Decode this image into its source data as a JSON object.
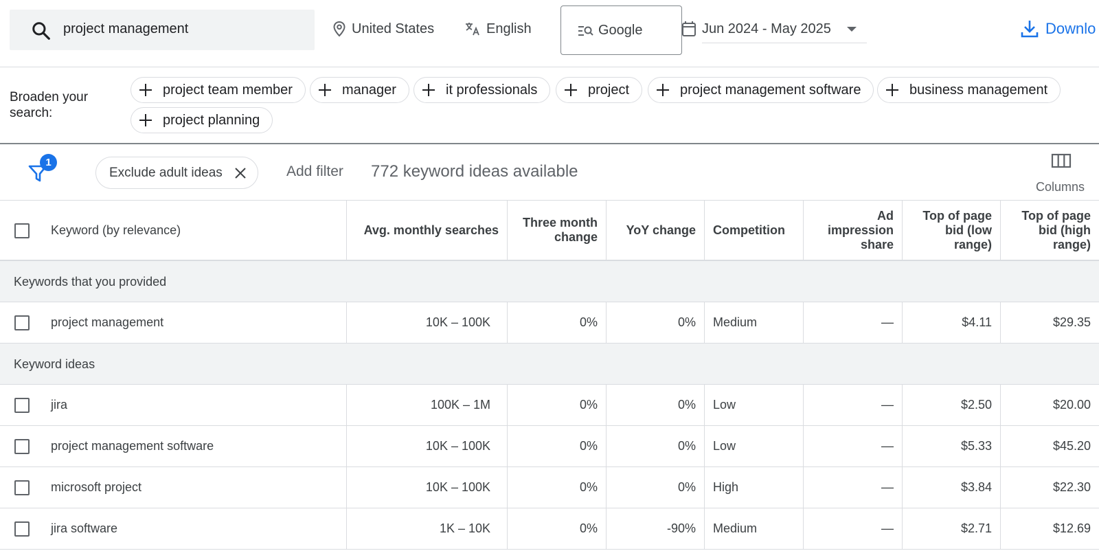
{
  "search": {
    "query": "project management"
  },
  "topbar": {
    "location": "United States",
    "language": "English",
    "engine": "Google",
    "date_range": "Jun 2024 - May 2025",
    "download_label": "Downlo"
  },
  "broaden": {
    "label": "Broaden your search:",
    "chips": [
      "project team member",
      "manager",
      "it professionals",
      "project",
      "project management software",
      "business management",
      "project planning"
    ]
  },
  "filters": {
    "badge_count": "1",
    "active_filter": "Exclude adult ideas",
    "add_filter_label": "Add filter",
    "ideas_count_text": "772 keyword ideas available",
    "columns_label": "Columns"
  },
  "table": {
    "headers": [
      "Keyword (by relevance)",
      "Avg. monthly searches",
      "Three month change",
      "YoY change",
      "Competition",
      "Ad impression share",
      "Top of page bid (low range)",
      "Top of page bid (high range)"
    ],
    "group_provided": "Keywords that you provided",
    "provided_rows": [
      [
        "project management",
        "10K – 100K",
        "0%",
        "0%",
        "Medium",
        "—",
        "$4.11",
        "$29.35"
      ]
    ],
    "group_ideas": "Keyword ideas",
    "idea_rows": [
      [
        "jira",
        "100K – 1M",
        "0%",
        "0%",
        "Low",
        "—",
        "$2.50",
        "$20.00"
      ],
      [
        "project management software",
        "10K – 100K",
        "0%",
        "0%",
        "Low",
        "—",
        "$5.33",
        "$45.20"
      ],
      [
        "microsoft project",
        "10K – 100K",
        "0%",
        "0%",
        "High",
        "—",
        "$3.84",
        "$22.30"
      ],
      [
        "jira software",
        "1K – 10K",
        "0%",
        "-90%",
        "Medium",
        "—",
        "$2.71",
        "$12.69"
      ]
    ]
  },
  "colors": {
    "accent": "#1a73e8",
    "border": "#dadce0",
    "group_bg": "#f1f3f4"
  }
}
